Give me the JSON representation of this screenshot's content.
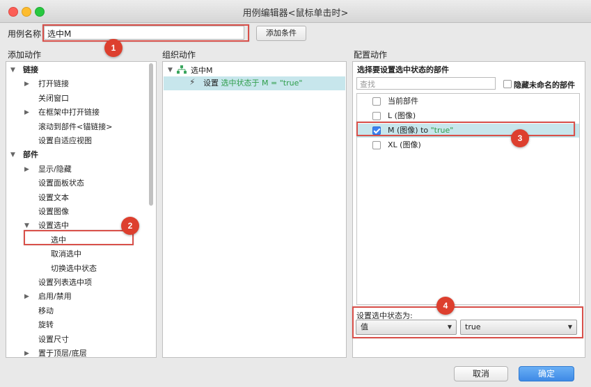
{
  "window": {
    "title": "用例编辑器<鼠标单击时>"
  },
  "case_name": {
    "label": "用例名称",
    "value": "选中M",
    "add_condition": "添加条件"
  },
  "columns": {
    "add_action": "添加动作",
    "organize_action": "组织动作",
    "configure_action": "配置动作"
  },
  "action_tree": [
    {
      "label": "链接",
      "arrow": "▼"
    },
    {
      "label": "打开链接",
      "arrow": "▶"
    },
    {
      "label": "关闭窗口",
      "arrow": ""
    },
    {
      "label": "在框架中打开链接",
      "arrow": "▶"
    },
    {
      "label": "滚动到部件<锚链接>",
      "arrow": ""
    },
    {
      "label": "设置自适应视图",
      "arrow": ""
    },
    {
      "label": "部件",
      "arrow": "▼"
    },
    {
      "label": "显示/隐藏",
      "arrow": "▶"
    },
    {
      "label": "设置面板状态",
      "arrow": ""
    },
    {
      "label": "设置文本",
      "arrow": ""
    },
    {
      "label": "设置图像",
      "arrow": ""
    },
    {
      "label": "设置选中",
      "arrow": "▼"
    },
    {
      "label": "选中",
      "arrow": ""
    },
    {
      "label": "取消选中",
      "arrow": ""
    },
    {
      "label": "切换选中状态",
      "arrow": ""
    },
    {
      "label": "设置列表选中项",
      "arrow": ""
    },
    {
      "label": "启用/禁用",
      "arrow": "▶"
    },
    {
      "label": "移动",
      "arrow": ""
    },
    {
      "label": "旋转",
      "arrow": ""
    },
    {
      "label": "设置尺寸",
      "arrow": ""
    },
    {
      "label": "置于顶层/底层",
      "arrow": "▶"
    }
  ],
  "organize": {
    "case_title": "选中M",
    "arrow": "▼",
    "action_prefix": "设置",
    "action_detail": "选中状态于 M = \"true\""
  },
  "configure": {
    "title": "选择要设置选中状态的部件",
    "search_placeholder": "查找",
    "hide_unnamed": "隐藏未命名的部件",
    "widgets": [
      {
        "label": "当前部件",
        "checked": false,
        "extra": ""
      },
      {
        "label": "L (图像)",
        "checked": false,
        "extra": ""
      },
      {
        "label": "M (图像) to ",
        "checked": true,
        "extra": "\"true\""
      },
      {
        "label": "XL (图像)",
        "checked": false,
        "extra": ""
      }
    ],
    "state_label": "设置选中状态为:",
    "value_select": "值",
    "state_select": "true"
  },
  "badges": [
    "1",
    "2",
    "3",
    "4"
  ],
  "buttons": {
    "cancel": "取消",
    "ok": "确定"
  },
  "colors": {
    "accent": "#3f8ae6",
    "highlight": "#c7e6ec",
    "callout": "#d9504a",
    "green_text": "#2e9d4a"
  }
}
